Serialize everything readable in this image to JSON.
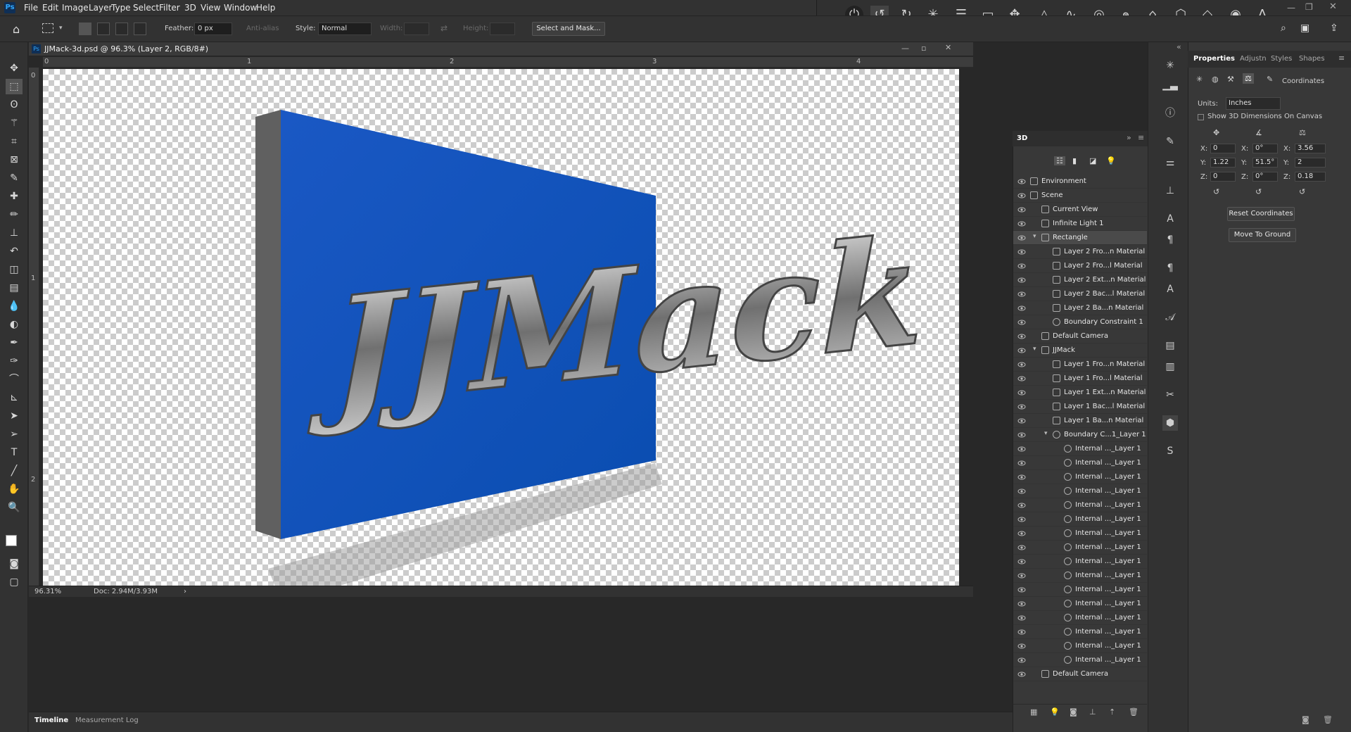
{
  "app": {
    "logo": "Ps"
  },
  "menu": [
    "File",
    "Edit",
    "Image",
    "Layer",
    "Type",
    "Select",
    "Filter",
    "3D",
    "View",
    "Window",
    "Help"
  ],
  "options": {
    "feather_label": "Feather:",
    "feather_value": "0 px",
    "antialias": "Anti-alias",
    "style_label": "Style:",
    "style_value": "Normal",
    "width_label": "Width:",
    "height_label": "Height:",
    "select_mask": "Select and Mask..."
  },
  "document": {
    "tab_title": "JJMack-3d.psd @ 96.3% (Layer 2, RGB/8#)",
    "zoom": "96.31%",
    "doc_info": "Doc: 2.94M/3.93M",
    "ruler_h": [
      "0",
      "1",
      "2",
      "3",
      "4"
    ],
    "ruler_v": [
      "0",
      "1",
      "2"
    ],
    "artwork_text": "JJMack"
  },
  "colors": {
    "panel_bg": "#383838",
    "accent_blue": "#0a5bbd",
    "selection_row": "#4a4a4a"
  },
  "timeline_tabs": [
    "Timeline",
    "Measurement Log"
  ],
  "panel3d": {
    "title": "3D",
    "rows": [
      {
        "label": "Environment",
        "indent": 0,
        "icon": "environment-icon"
      },
      {
        "label": "Scene",
        "indent": 0,
        "icon": "scene-icon"
      },
      {
        "label": "Current View",
        "indent": 1,
        "icon": "camera-icon"
      },
      {
        "label": "Infinite Light 1",
        "indent": 1,
        "icon": "light-icon"
      },
      {
        "label": "Rectangle",
        "indent": 1,
        "icon": "mesh-icon",
        "selected": true,
        "expand": true
      },
      {
        "label": "Layer 2 Fro...n Material",
        "indent": 2,
        "icon": "material-icon"
      },
      {
        "label": "Layer 2 Fro...l Material",
        "indent": 2,
        "icon": "material-icon"
      },
      {
        "label": "Layer 2 Ext...n Material",
        "indent": 2,
        "icon": "material-icon"
      },
      {
        "label": "Layer 2 Bac...l Material",
        "indent": 2,
        "icon": "material-icon"
      },
      {
        "label": "Layer 2 Ba...n Material",
        "indent": 2,
        "icon": "material-icon"
      },
      {
        "label": "Boundary Constraint 1",
        "indent": 2,
        "icon": "constraint-icon"
      },
      {
        "label": "Default Camera",
        "indent": 1,
        "icon": "camera-icon"
      },
      {
        "label": "JJMack",
        "indent": 1,
        "icon": "mesh-icon",
        "expand": true
      },
      {
        "label": "Layer 1 Fro...n Material",
        "indent": 2,
        "icon": "material-icon"
      },
      {
        "label": "Layer 1 Fro...l Material",
        "indent": 2,
        "icon": "material-icon"
      },
      {
        "label": "Layer 1 Ext...n Material",
        "indent": 2,
        "icon": "material-icon"
      },
      {
        "label": "Layer 1 Bac...l Material",
        "indent": 2,
        "icon": "material-icon"
      },
      {
        "label": "Layer 1 Ba...n Material",
        "indent": 2,
        "icon": "material-icon"
      },
      {
        "label": "Boundary C...1_Layer 1",
        "indent": 2,
        "icon": "constraint-icon",
        "expand": true
      },
      {
        "label": "Internal ..._Layer 1",
        "indent": 3,
        "icon": "constraint-icon"
      },
      {
        "label": "Internal ..._Layer 1",
        "indent": 3,
        "icon": "constraint-icon"
      },
      {
        "label": "Internal ..._Layer 1",
        "indent": 3,
        "icon": "constraint-icon"
      },
      {
        "label": "Internal ..._Layer 1",
        "indent": 3,
        "icon": "constraint-icon"
      },
      {
        "label": "Internal ..._Layer 1",
        "indent": 3,
        "icon": "constraint-icon"
      },
      {
        "label": "Internal ..._Layer 1",
        "indent": 3,
        "icon": "constraint-icon"
      },
      {
        "label": "Internal ..._Layer 1",
        "indent": 3,
        "icon": "constraint-icon"
      },
      {
        "label": "Internal ..._Layer 1",
        "indent": 3,
        "icon": "constraint-icon"
      },
      {
        "label": "Internal ..._Layer 1",
        "indent": 3,
        "icon": "constraint-icon"
      },
      {
        "label": "Internal ..._Layer 1",
        "indent": 3,
        "icon": "constraint-icon"
      },
      {
        "label": "Internal ..._Layer 1",
        "indent": 3,
        "icon": "constraint-icon"
      },
      {
        "label": "Internal ..._Layer 1",
        "indent": 3,
        "icon": "constraint-icon"
      },
      {
        "label": "Internal ..._Layer 1",
        "indent": 3,
        "icon": "constraint-icon"
      },
      {
        "label": "Internal ..._Layer 1",
        "indent": 3,
        "icon": "constraint-icon"
      },
      {
        "label": "Internal ..._Layer 1",
        "indent": 3,
        "icon": "constraint-icon"
      },
      {
        "label": "Internal ..._Layer 1",
        "indent": 3,
        "icon": "constraint-icon"
      },
      {
        "label": "Default Camera",
        "indent": 1,
        "icon": "camera-icon"
      }
    ]
  },
  "properties": {
    "tabs": [
      "Properties",
      "Adjustn",
      "Styles",
      "Shapes"
    ],
    "section": "Coordinates",
    "units_label": "Units:",
    "units_value": "Inches",
    "show_dims": "Show 3D Dimensions On Canvas",
    "pos": {
      "x": "0",
      "y": "1.22",
      "z": "0"
    },
    "rot": {
      "x": "0°",
      "y": "51.5°",
      "z": "0°"
    },
    "scale": {
      "x": "3.56",
      "y": "2",
      "z": "0.18"
    },
    "labels": {
      "x": "X:",
      "y": "Y:",
      "z": "Z:"
    },
    "reset": "Reset Coordinates",
    "ground": "Move To Ground"
  }
}
